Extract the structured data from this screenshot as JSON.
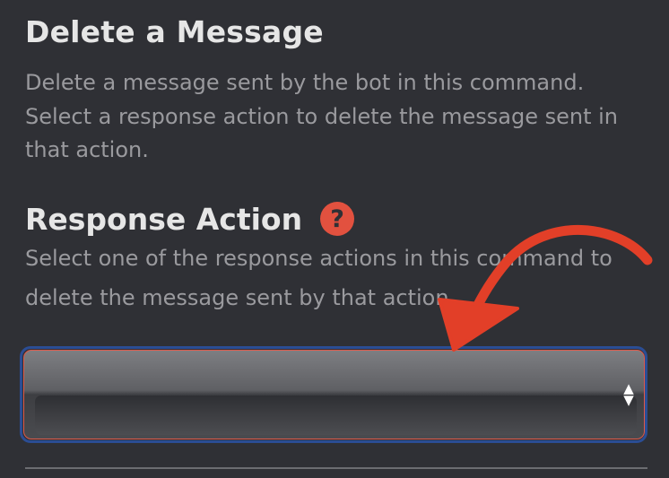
{
  "delete_message": {
    "title": "Delete a Message",
    "description": "Delete a message sent by the bot in this command. Select a response action to delete the message sent in that action."
  },
  "response_action": {
    "title": "Response Action",
    "help_icon": "?",
    "description": "Select one of the response actions in this command to delete the message sent by that action.",
    "select_value": ""
  },
  "icons": {
    "help": "question-mark-circle-icon",
    "stepper": "up-down-chevron-icon",
    "annotation": "curved-arrow-icon"
  },
  "colors": {
    "background": "#2f3035",
    "accent": "#e2513f",
    "focus_ring": "#2b4d94"
  }
}
